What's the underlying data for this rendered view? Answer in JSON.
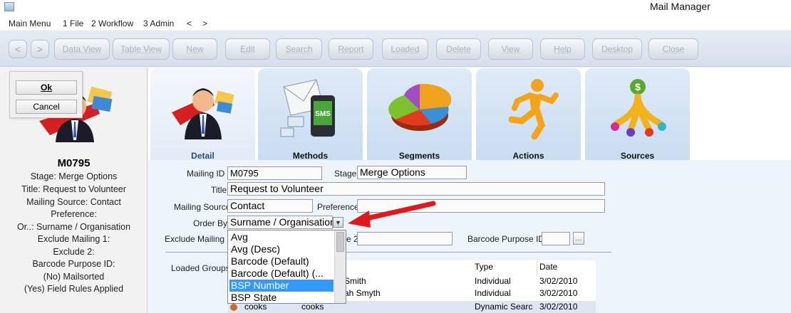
{
  "window": {
    "title": "Mail Manager"
  },
  "menu": [
    "Main Menu",
    "1 File",
    "2 Workflow",
    "3 Admin",
    "<",
    ">"
  ],
  "toolbar": {
    "back": "<",
    "forward": ">",
    "buttons": [
      "Data View",
      "Table View",
      "New",
      "Edit",
      "Search",
      "Report",
      "Loaded",
      "Delete",
      "View",
      "Help",
      "Desktop",
      "Close"
    ]
  },
  "dialog": {
    "ok": "Ok",
    "cancel": "Cancel"
  },
  "summary": {
    "code": "M0795",
    "lines": [
      "Stage: Merge Options",
      "Title: Request to Volunteer",
      "Mailing Source: Contact",
      "Preference:",
      "Or..: Surname / Organisation",
      "Exclude Mailing 1:",
      "Exclude 2:",
      "Barcode Purpose ID:",
      "(No) Mailsorted",
      "(Yes) Field Rules Applied"
    ]
  },
  "tabs": [
    {
      "label": "Detail",
      "icon": "person-mail-icon"
    },
    {
      "label": "Methods",
      "icon": "sms-phone-icon"
    },
    {
      "label": "Segments",
      "icon": "pie-chart-icon"
    },
    {
      "label": "Actions",
      "icon": "running-man-icon"
    },
    {
      "label": "Sources",
      "icon": "money-tree-icon"
    }
  ],
  "form": {
    "mailing_id_label": "Mailing ID",
    "mailing_id": "M0795",
    "stage_label": "Stage",
    "stage": "Merge Options",
    "title_label": "Title",
    "title": "Request to Volunteer",
    "source_label": "Mailing Source",
    "source": "Contact",
    "preference_label": "Preference",
    "preference": "",
    "order_by_label": "Order By",
    "order_by": "Surname / Organisation",
    "exclude1_label": "Exclude Mailing 1",
    "exclude2_label_tail": "e 2",
    "barcode_label": "Barcode Purpose ID",
    "loaded_groups_label": "Loaded Groups"
  },
  "dropdown": {
    "options": [
      "Avg",
      "Avg (Desc)",
      "Barcode (Default)",
      "Barcode (Default) (...",
      "BSP Number",
      "BSP State"
    ],
    "selected_index": 4
  },
  "grid": {
    "headers": [
      "Type",
      "Date"
    ],
    "rows": [
      {
        "name": "Smith",
        "type": "Individual",
        "date": "3/02/2010"
      },
      {
        "name": "ah Smyth",
        "type": "Individual",
        "date": "3/02/2010"
      },
      {
        "code": "cooks",
        "name": "cooks",
        "type": "Dynamic Searc",
        "date": "3/02/2010"
      }
    ]
  },
  "colors": {
    "selected": "#3399ff",
    "arrow": "#e01a1a",
    "tab_active_label": "#1e4c8e"
  }
}
